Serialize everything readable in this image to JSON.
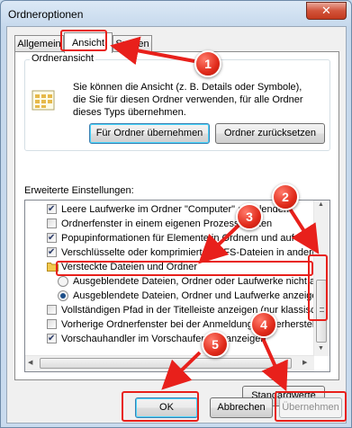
{
  "window": {
    "title": "Ordneroptionen",
    "close_glyph": "✕"
  },
  "tabs": [
    {
      "label": "Allgemein",
      "active": false
    },
    {
      "label": "Ansicht",
      "active": true
    },
    {
      "label": "Suchen",
      "active": false
    }
  ],
  "folder_view": {
    "group_label": "Ordneransicht",
    "icon": "folder-view-icon",
    "description": "Sie können die Ansicht (z. B. Details oder Symbole), die Sie für diesen Ordner verwenden, für alle Ordner dieses Typs übernehmen.",
    "apply_button": "Für Ordner übernehmen",
    "reset_button": "Ordner zurücksetzen"
  },
  "advanced": {
    "label": "Erweiterte Einstellungen:",
    "items": [
      {
        "kind": "checkbox",
        "checked": true,
        "label": "Leere Laufwerke im Ordner \"Computer\" ausblenden"
      },
      {
        "kind": "checkbox",
        "checked": false,
        "label": "Ordnerfenster in einem eigenen Prozess starten"
      },
      {
        "kind": "checkbox",
        "checked": true,
        "label": "Popupinformationen für Elemente in Ordnern und auf dem D"
      },
      {
        "kind": "checkbox",
        "checked": true,
        "label": "Verschlüsselte oder komprimierte NTFS-Dateien in anderer"
      },
      {
        "kind": "folder",
        "label": "Versteckte Dateien und Ordner"
      },
      {
        "kind": "radio",
        "checked": false,
        "label": "Ausgeblendete Dateien, Ordner oder Laufwerke nicht a"
      },
      {
        "kind": "radio",
        "checked": true,
        "label": "Ausgeblendete Dateien, Ordner und Laufwerke anzeige"
      },
      {
        "kind": "checkbox",
        "checked": false,
        "label": "Vollständigen Pfad in der Titelleiste anzeigen (nur klassisch"
      },
      {
        "kind": "checkbox",
        "checked": false,
        "label": "Vorherige Ordnerfenster bei der Anmeldung wiederherstellen"
      },
      {
        "kind": "checkbox",
        "checked": true,
        "label": "Vorschauhandler im Vorschaufenster anzeigen"
      }
    ],
    "defaults_button": "Standardwerte"
  },
  "footer": {
    "ok": "OK",
    "cancel": "Abbrechen",
    "apply": "Übernehmen"
  },
  "callouts": [
    "1",
    "2",
    "3",
    "4",
    "5"
  ],
  "colors": {
    "highlight": "#e8201b",
    "accent": "#3c7fb1"
  }
}
